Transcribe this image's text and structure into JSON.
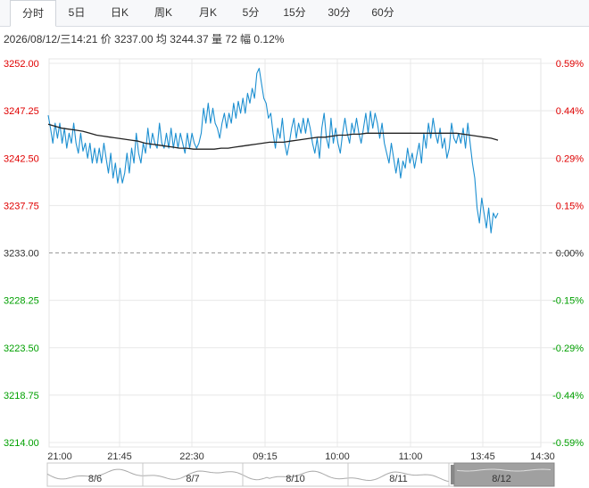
{
  "tabs": [
    {
      "label": "分时",
      "active": true
    },
    {
      "label": "5日"
    },
    {
      "label": "日K"
    },
    {
      "label": "周K"
    },
    {
      "label": "月K"
    },
    {
      "label": "5分"
    },
    {
      "label": "15分"
    },
    {
      "label": "30分"
    },
    {
      "label": "60分"
    }
  ],
  "info": {
    "datetime": "2026/08/12/三14:21",
    "price_label": "价",
    "price": "3237.00",
    "avg_label": "均",
    "avg": "3244.37",
    "volume_label": "量",
    "volume": "72",
    "change_label": "幅",
    "change": "0.12%"
  },
  "colors": {
    "up": "#e00000",
    "down": "#00a000",
    "price_line": "#1c8fd1",
    "avg_line": "#222222",
    "grid": "#e8e8e8",
    "base_line": "#999999"
  },
  "chart_data": {
    "type": "line",
    "base_price": 3233.0,
    "ylim": [
      3214.0,
      3252.0
    ],
    "left_ticks": [
      "3252.00",
      "3247.25",
      "3242.50",
      "3237.75",
      "3233.00",
      "3228.25",
      "3223.50",
      "3218.75",
      "3214.00"
    ],
    "right_ticks": [
      "0.59%",
      "0.44%",
      "0.29%",
      "0.15%",
      "0.00%",
      "-0.15%",
      "-0.29%",
      "-0.44%",
      "-0.59%"
    ],
    "x_ticks": [
      "21:00",
      "21:45",
      "22:30",
      "09:15",
      "10:00",
      "11:00",
      "13:45",
      "14:30"
    ],
    "series": [
      {
        "key": "price",
        "values": [
          3246.8,
          3245.5,
          3244,
          3246,
          3244.5,
          3246,
          3244,
          3245.5,
          3243.5,
          3245,
          3244,
          3246,
          3244,
          3243,
          3245,
          3243.2,
          3244,
          3242.5,
          3244,
          3242,
          3243.5,
          3242,
          3243.5,
          3242,
          3244,
          3242.5,
          3241,
          3243,
          3240.5,
          3242,
          3240,
          3241.5,
          3240,
          3241,
          3243,
          3241,
          3243.5,
          3242,
          3245,
          3243,
          3242,
          3244,
          3243,
          3245.5,
          3243.5,
          3245,
          3244,
          3243.5,
          3246,
          3244,
          3243.5,
          3245,
          3243.5,
          3245.5,
          3243.5,
          3245,
          3243.5,
          3245,
          3244,
          3243,
          3245,
          3243.5,
          3245,
          3244,
          3243.5,
          3244,
          3245,
          3247.5,
          3246,
          3248,
          3246,
          3247.5,
          3246,
          3245.5,
          3244.5,
          3246,
          3247,
          3245.5,
          3247,
          3246,
          3248,
          3246.5,
          3248.2,
          3247,
          3248.5,
          3247,
          3249,
          3248,
          3249.5,
          3248.5,
          3251,
          3251.5,
          3250,
          3248.5,
          3248,
          3246.5,
          3247,
          3245,
          3243.5,
          3245.5,
          3244.5,
          3246.5,
          3244,
          3242.8,
          3244,
          3245.5,
          3246.5,
          3244.5,
          3246,
          3245,
          3246.5,
          3245,
          3246.5,
          3245.5,
          3244,
          3243,
          3244.5,
          3242.5,
          3245.5,
          3247,
          3244.5,
          3243.5,
          3246.5,
          3244,
          3245.5,
          3244,
          3243,
          3245,
          3246.5,
          3245,
          3244,
          3246,
          3245,
          3246.5,
          3245,
          3244,
          3245.5,
          3247,
          3245,
          3247.2,
          3245.5,
          3247,
          3246,
          3244.5,
          3246,
          3244,
          3243,
          3242,
          3244,
          3242.5,
          3241,
          3242.5,
          3240.5,
          3242.2,
          3241.5,
          3243.5,
          3242,
          3243,
          3241.5,
          3242.8,
          3244,
          3242,
          3245,
          3243.5,
          3246,
          3244.5,
          3246.5,
          3245,
          3244,
          3245.5,
          3243.5,
          3244.5,
          3242.5,
          3243.5,
          3246,
          3244.5,
          3244,
          3245,
          3244,
          3245.5,
          3243.5,
          3246,
          3244,
          3242,
          3240.5,
          3237.5,
          3236,
          3238.5,
          3237,
          3235.5,
          3237.5,
          3235,
          3237,
          3236.5,
          3237
        ]
      },
      {
        "key": "avg",
        "values": [
          3245.9,
          3245.7,
          3245.5,
          3245.4,
          3245.3,
          3245.2,
          3245.0,
          3244.8,
          3244.7,
          3244.6,
          3244.5,
          3244.4,
          3244.3,
          3244.2,
          3244.0,
          3243.9,
          3243.8,
          3243.7,
          3243.6,
          3243.5,
          3243.5,
          3243.4,
          3243.4,
          3243.4,
          3243.4,
          3243.5,
          3243.5,
          3243.6,
          3243.7,
          3243.8,
          3243.9,
          3244.0,
          3244.1,
          3244.1,
          3244.1,
          3244.2,
          3244.3,
          3244.4,
          3244.5,
          3244.6,
          3244.6,
          3244.7,
          3244.8,
          3244.8,
          3244.9,
          3244.9,
          3245.0,
          3245.0,
          3245.0,
          3245.0,
          3245.0,
          3245.0,
          3245.0,
          3245.0,
          3245.0,
          3245.0,
          3245.0,
          3245.0,
          3245.0,
          3245.0,
          3244.9,
          3244.8,
          3244.7,
          3244.6,
          3244.5,
          3244.3
        ]
      }
    ]
  },
  "navigator": {
    "dates": [
      "8/6",
      "8/7",
      "8/10",
      "8/11",
      "8/12"
    ],
    "selected": "8/12"
  }
}
